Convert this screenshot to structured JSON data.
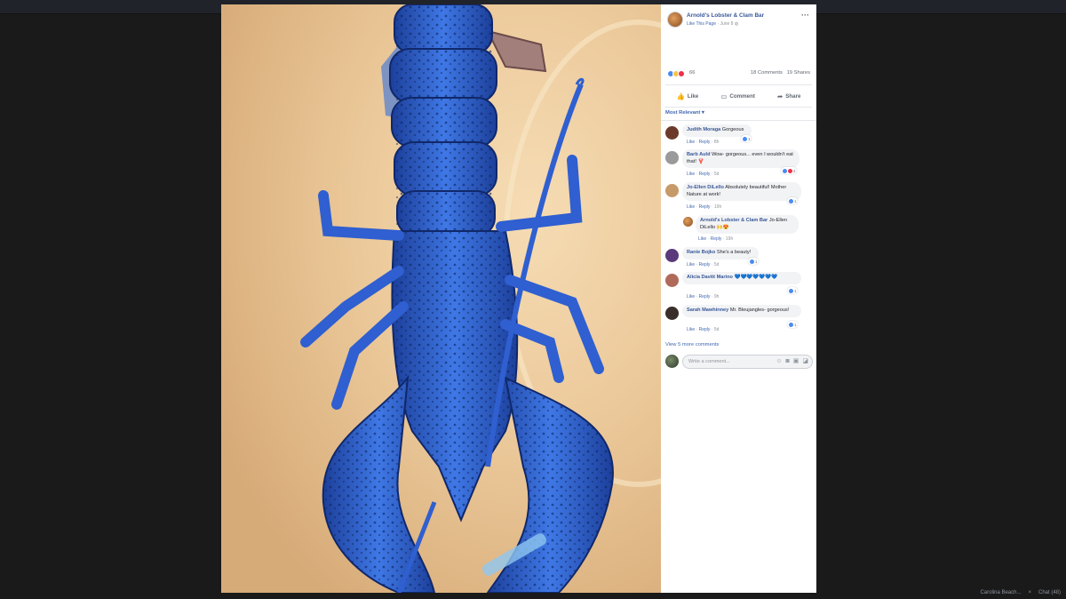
{
  "post": {
    "page_name": "Arnold's Lobster & Clam Bar",
    "like_page": "Like This Page",
    "date": "June 8",
    "reaction_count": "66",
    "comments_count": "18 Comments",
    "shares_count": "19 Shares"
  },
  "actions": {
    "like": "Like",
    "comment": "Comment",
    "share": "Share"
  },
  "sort_label": "Most Relevant ▾",
  "comment_meta": {
    "like": "Like",
    "reply": "Reply"
  },
  "comments": [
    {
      "name": "Judith Moraga",
      "text": "Gorgeous",
      "time": "8h",
      "reacts": "1"
    },
    {
      "name": "Barb Auld",
      "text": "Wow- gorgeous... even I wouldn't eat that! 🦞",
      "time": "5d",
      "reacts": "2"
    },
    {
      "name": "Jo-Ellen DiLello",
      "text": "Absolutely beautiful! Mother Nature at work!",
      "time": "19h",
      "reacts": "1"
    },
    {
      "name": "Arnold's Lobster & Clam Bar",
      "text": "Jo-Ellen DiLello 🙌😍",
      "time": "19h",
      "reacts": ""
    },
    {
      "name": "Ranie Bojko",
      "text": "She's a beauty!",
      "time": "5d",
      "reacts": "1"
    },
    {
      "name": "Alicia Davitt Marino",
      "text": "💙💙💙💙💙💙💙",
      "time": "9h",
      "reacts": "1"
    },
    {
      "name": "Sarah Mawhinney",
      "text": "Mr. Bleujangles- gorgeous!",
      "time": "5d",
      "reacts": "1"
    }
  ],
  "view_more": "View 5 more comments",
  "write_placeholder": "Write a comment...",
  "chatbar": {
    "item1": "Carolina Beach...",
    "item2": "Chat (48)"
  },
  "colors": {
    "link_blue": "#385898",
    "accent": "#4267b2",
    "lobster_blue": "#2f5fd0"
  },
  "icons": [
    "more-icon",
    "like-icon",
    "comment-icon",
    "share-icon",
    "emoji-icon",
    "camera-icon",
    "gif-icon",
    "sticker-icon"
  ]
}
